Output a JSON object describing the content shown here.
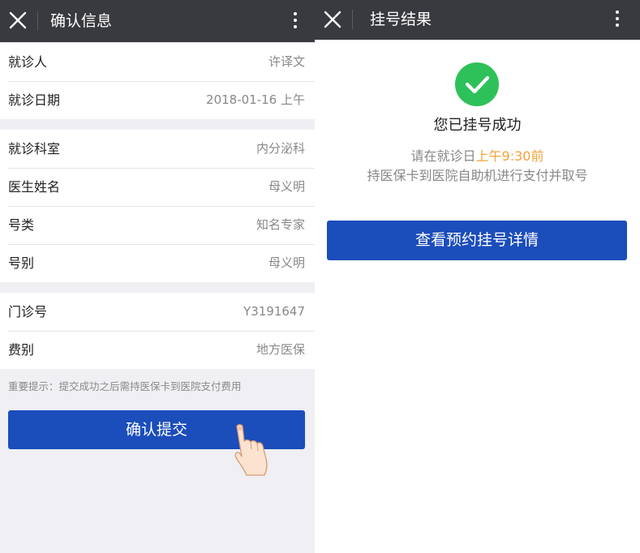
{
  "confirm_screen": {
    "title": "确认信息",
    "groups": [
      [
        {
          "label": "就诊人",
          "value": "许译文"
        },
        {
          "label": "就诊日期",
          "value": "2018-01-16 上午"
        }
      ],
      [
        {
          "label": "就诊科室",
          "value": "内分泌科"
        },
        {
          "label": "医生姓名",
          "value": "母义明"
        },
        {
          "label": "号类",
          "value": "知名专家"
        },
        {
          "label": "号别",
          "value": "母义明"
        }
      ],
      [
        {
          "label": "门诊号",
          "value": "Y3191647"
        },
        {
          "label": "费别",
          "value": "地方医保"
        }
      ]
    ],
    "tip": "重要提示：提交成功之后需持医保卡到医院支付费用",
    "submit_label": "确认提交"
  },
  "result_screen": {
    "title": "挂号结果",
    "success_text": "您已挂号成功",
    "line1_prefix": "请在就诊日",
    "line1_highlight": "上午9:30前",
    "line2": "持医保卡到医院自助机进行支付并取号",
    "details_button": "查看预约挂号详情"
  },
  "colors": {
    "topbar": "#393a3f",
    "primary": "#1b4dbb",
    "success": "#2ec15a",
    "highlight": "#f2a33a",
    "page_bg": "#efeff4"
  },
  "icons": [
    "close-icon",
    "more-vertical-icon",
    "check-circle-icon",
    "pointing-hand-icon"
  ]
}
